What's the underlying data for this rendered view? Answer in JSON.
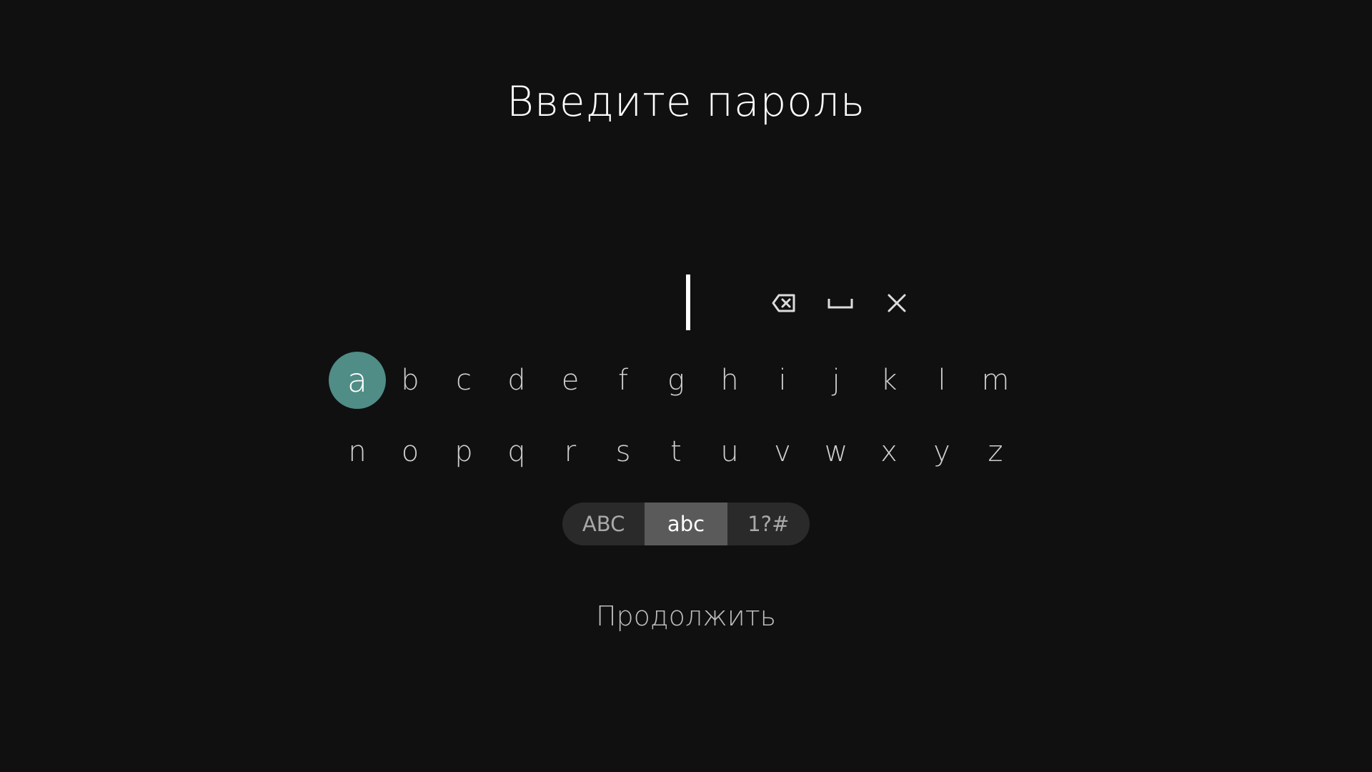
{
  "title": "Введите пароль",
  "password": {
    "value": ""
  },
  "controls": {
    "backspace_icon": "backspace-icon",
    "space_icon": "space-icon",
    "close_icon": "close-icon"
  },
  "keyboard": {
    "row1": [
      "a",
      "b",
      "c",
      "d",
      "e",
      "f",
      "g",
      "h",
      "i",
      "j",
      "k",
      "l",
      "m"
    ],
    "row2": [
      "n",
      "o",
      "p",
      "q",
      "r",
      "s",
      "t",
      "u",
      "v",
      "w",
      "x",
      "y",
      "z"
    ],
    "focused_key": "a"
  },
  "modes": {
    "upper": "ABC",
    "lower": "abc",
    "symbols": "1?#",
    "active": "abc"
  },
  "continue_label": "Продолжить",
  "colors": {
    "background": "#101010",
    "focus_accent": "#4f8d86",
    "mode_active": "#5a5a5a"
  }
}
